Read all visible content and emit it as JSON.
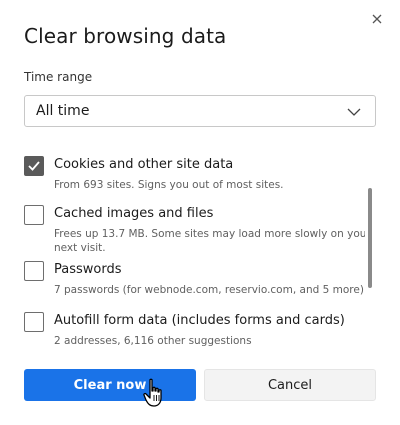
{
  "dialog": {
    "title": "Clear browsing data",
    "close_icon": "close-icon"
  },
  "time_range": {
    "label": "Time range",
    "selected": "All time",
    "chevron_icon": "chevron-down-icon"
  },
  "items": [
    {
      "title": "Cookies and other site data",
      "description": "From 693 sites. Signs you out of most sites.",
      "checked": true
    },
    {
      "title": "Cached images and files",
      "description": "Frees up 13.7 MB. Some sites may load more slowly on your next visit.",
      "checked": false
    },
    {
      "title": "Passwords",
      "description": "7 passwords (for webnode.com, reservio.com, and 5 more)",
      "checked": false
    },
    {
      "title": "Autofill form data (includes forms and cards)",
      "description": "2 addresses, 6,116 other suggestions",
      "checked": false
    }
  ],
  "buttons": {
    "clear_label": "Clear now",
    "cancel_label": "Cancel"
  },
  "colors": {
    "primary": "#1a73e8",
    "checkbox_checked": "#5a5a5a"
  }
}
